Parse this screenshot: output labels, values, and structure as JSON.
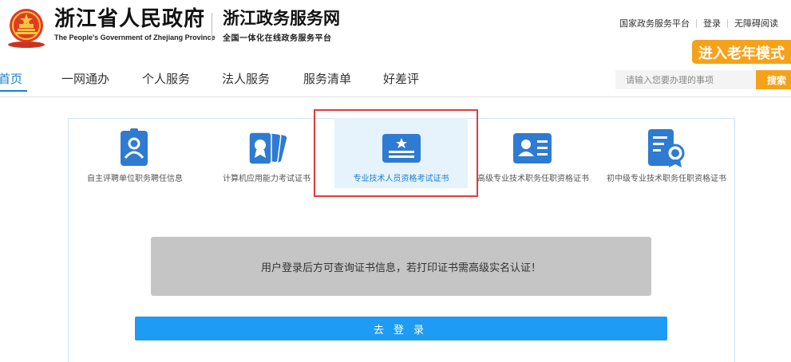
{
  "header": {
    "gov_title": "浙江省人民政府",
    "gov_subtitle": "The People's Government of Zhejiang Province",
    "site_title": "浙江政务服务网",
    "site_subtitle": "全国一体化在线政务服务平台"
  },
  "top_links": {
    "national_platform": "国家政务服务平台",
    "login": "登录",
    "accessibility": "无障碍阅读"
  },
  "elder_mode_label": "进入老年模式",
  "nav": {
    "items": [
      {
        "label": "首页"
      },
      {
        "label": "一网通办"
      },
      {
        "label": "个人服务"
      },
      {
        "label": "法人服务"
      },
      {
        "label": "服务清单"
      },
      {
        "label": "好差评"
      }
    ],
    "active_index": 0
  },
  "search": {
    "placeholder": "请输入您要办理的事项",
    "button_label": "搜索"
  },
  "cert_cards": [
    {
      "label": "自主评聘单位职务聘任信息",
      "icon": "person-badge-icon"
    },
    {
      "label": "计算机应用能力考试证书",
      "icon": "certificate-cards-icon"
    },
    {
      "label": "专业技术人员资格考试证书",
      "icon": "star-certificate-icon",
      "active": true
    },
    {
      "label": "高级专业技术职务任职资格证书",
      "icon": "id-card-icon"
    },
    {
      "label": "初中级专业技术职务任职资格证书",
      "icon": "document-medal-icon"
    }
  ],
  "notice_text": "用户登录后方可查询证书信息，若打印证书需高级实名认证！",
  "login_button_label": "去登录",
  "colors": {
    "brand_blue": "#1a7fd4",
    "icon_blue": "#2e7bd1",
    "orange": "#f5a21b",
    "button_blue": "#1e9bf5",
    "highlight_red": "#e33b3b"
  }
}
